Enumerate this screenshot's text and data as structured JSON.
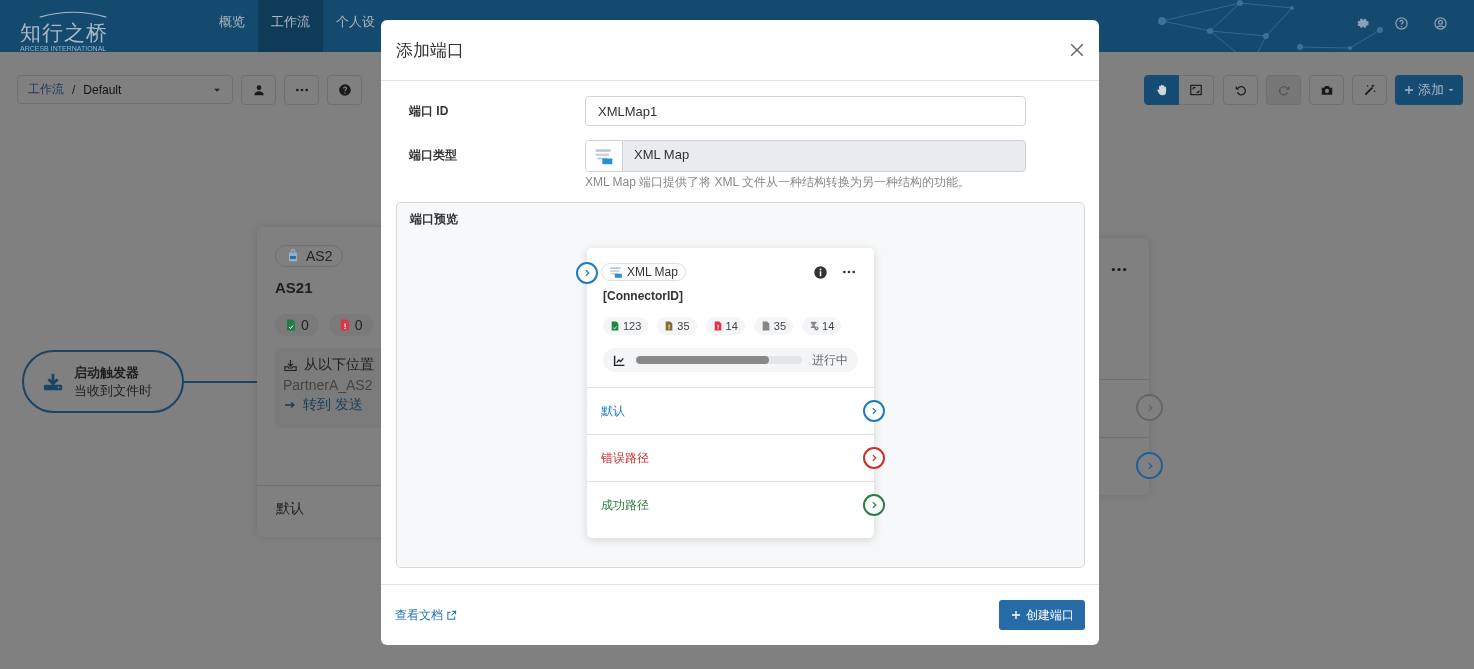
{
  "header": {
    "logo": "知行之桥",
    "logo_subtitle": "ARCESB INTERNATIONAL",
    "nav": [
      {
        "label": "概览",
        "selected": false
      },
      {
        "label": "工作流",
        "selected": true
      },
      {
        "label": "个人设",
        "selected": false
      }
    ],
    "icons": [
      {
        "kind": "settings"
      },
      {
        "kind": "help"
      },
      {
        "kind": "account"
      }
    ]
  },
  "toolbar": {
    "separator": "/",
    "breadcrumb": [
      {
        "label": "工作流",
        "kind": "link"
      },
      {
        "label": "Default",
        "kind": "current"
      }
    ],
    "left_buttons": [
      {
        "kind": "user"
      },
      {
        "kind": "more"
      },
      {
        "kind": "help"
      }
    ],
    "view_modes": [
      {
        "kind": "hand",
        "selected": true
      },
      {
        "kind": "fit",
        "selected": false
      }
    ],
    "actions": [
      {
        "kind": "undo",
        "disabled": false
      },
      {
        "kind": "redo",
        "disabled": true
      },
      {
        "kind": "camera",
        "disabled": false
      },
      {
        "kind": "wand",
        "disabled": false
      }
    ],
    "add_button": "添加"
  },
  "canvas": {
    "trigger": {
      "title": "启动触发器",
      "subtitle": "当收到文件时"
    },
    "connector": {
      "type_badge": "AS2",
      "name": "AS21",
      "counts": [
        {
          "kind": "success",
          "value": "0",
          "color": "#1e7e45"
        },
        {
          "kind": "error",
          "value": "0",
          "color": "#dc3545"
        }
      ],
      "receive_label": "从以下位置",
      "receive_value": "PartnerA_AS2",
      "goto": "转到 发送",
      "output": "默认"
    },
    "right_card": {
      "ports": [
        {
          "color": "#666666"
        },
        {
          "color": "#1f5f96"
        }
      ]
    }
  },
  "modal": {
    "title": "添加端口",
    "fields": [
      {
        "kind": "text",
        "label": "端口 ID",
        "value": "XMLMap1"
      },
      {
        "kind": "type",
        "label": "端口类型",
        "value": "XML Map",
        "help": "XML Map 端口提供了将 XML 文件从一种结构转换为另一种结构的功能。"
      }
    ],
    "preview": {
      "label": "端口预览",
      "badge": "XML Map",
      "name": "[ConnectorID]",
      "stats": [
        {
          "kind": "success",
          "value": "123",
          "color": "#1e8449"
        },
        {
          "kind": "warning",
          "value": "35",
          "color": "#8a6a33"
        },
        {
          "kind": "error",
          "value": "14",
          "color": "#dc3545"
        },
        {
          "kind": "file",
          "value": "35",
          "color": "#888888"
        },
        {
          "kind": "pending",
          "value": "14",
          "color": "#888888"
        }
      ],
      "progress": {
        "level": 0.8,
        "status": "进行中"
      },
      "outputs": [
        {
          "label": "默认",
          "color": "#1f7bc1"
        },
        {
          "label": "错误路径",
          "color": "#c9302c"
        },
        {
          "label": "成功路径",
          "color": "#2e7d40"
        }
      ]
    },
    "footer": {
      "link": "查看文档",
      "button": "创建端口"
    }
  }
}
